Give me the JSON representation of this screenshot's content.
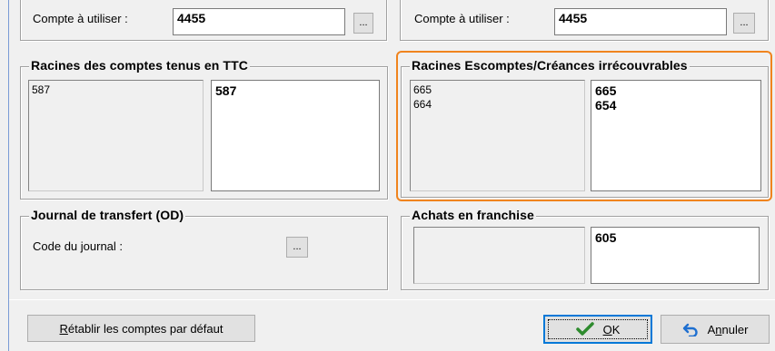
{
  "top_left": {
    "label": "Compte à utiliser :",
    "value": "4455",
    "button": "..."
  },
  "top_right": {
    "label": "Compte à utiliser :",
    "value": "4455",
    "button": "..."
  },
  "ttc_group": {
    "title": "Racines des comptes tenus en TTC",
    "left_items": [
      "587"
    ],
    "right_items": [
      "587"
    ]
  },
  "escompte_group": {
    "title": "Racines Escomptes/Créances irrécouvrables",
    "left_items": [
      "665",
      "664"
    ],
    "right_items": [
      "665",
      "654"
    ],
    "highlight_color": "#f0841e"
  },
  "journal_group": {
    "title": "Journal de transfert (OD)",
    "label": "Code du journal :",
    "button": "..."
  },
  "franchise_group": {
    "title": "Achats en franchise",
    "right_items": [
      "605"
    ]
  },
  "footer": {
    "reset_button": {
      "mnemonic": "R",
      "rest": "établir les comptes par défaut"
    },
    "ok_button": {
      "mnemonic": "O",
      "rest": "K",
      "icon": "checkmark-icon"
    },
    "cancel_button": {
      "prefix": "A",
      "mnemonic": "n",
      "rest": "nuler",
      "icon": "undo-arrow-icon"
    }
  },
  "colors": {
    "accent": "#0078d7",
    "check": "#2e8b2e",
    "undo": "#1e6fd0"
  }
}
